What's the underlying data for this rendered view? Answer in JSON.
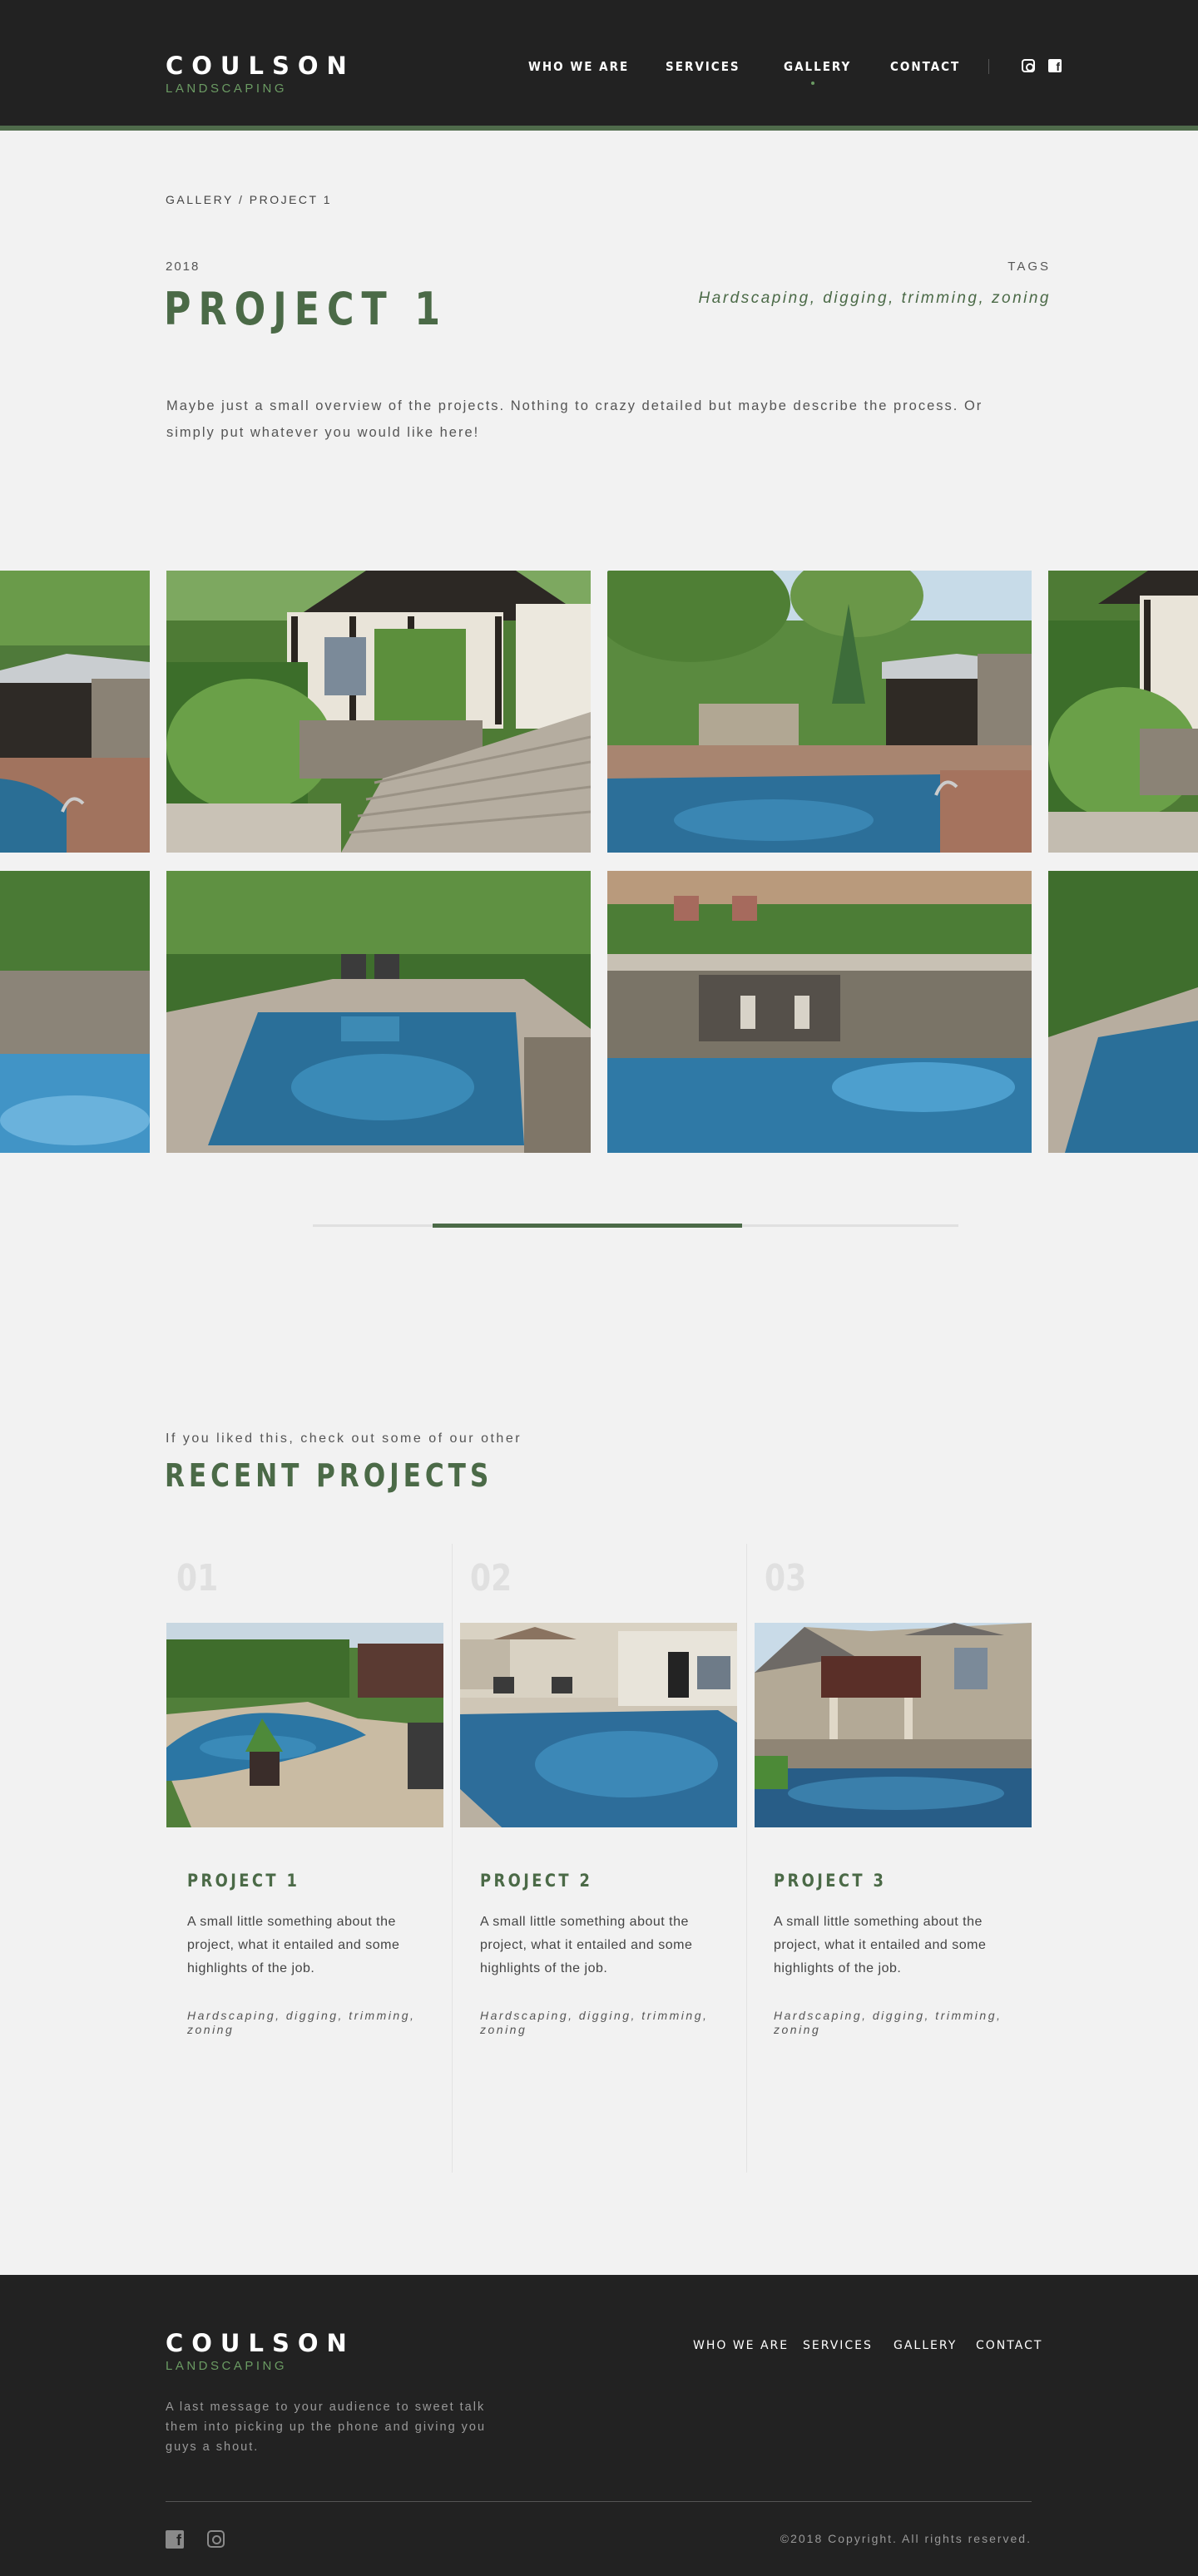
{
  "brand": {
    "name": "COULSON",
    "tagline": "LANDSCAPING"
  },
  "nav": {
    "items": [
      "WHO WE ARE",
      "SERVICES",
      "GALLERY",
      "CONTACT"
    ],
    "active": "GALLERY"
  },
  "social": {
    "icons": [
      "instagram-icon",
      "facebook-icon"
    ]
  },
  "breadcrumb": "GALLERY / PROJECT 1",
  "project": {
    "year": "2018",
    "title": "PROJECT 1",
    "tags_label": "TAGS",
    "tags": "Hardscaping, digging, trimming, zoning",
    "overview": "Maybe just a small overview of the projects. Nothing to crazy detailed but maybe describe the process. Or simply put whatever you would like here!"
  },
  "gallery": {
    "scroll_progress": 0.37
  },
  "recent": {
    "intro": "If you liked this, check out some of our other",
    "title": "RECENT PROJECTS",
    "cards": [
      {
        "num": "01",
        "title": "PROJECT 1",
        "text": "A small little something about the project, what it entailed and some highlights of the job.",
        "tags": "Hardscaping, digging, trimming, zoning"
      },
      {
        "num": "02",
        "title": "PROJECT 2",
        "text": "A small little something about the project, what it entailed and some highlights of the job.",
        "tags": "Hardscaping, digging, trimming, zoning"
      },
      {
        "num": "03",
        "title": "PROJECT 3",
        "text": "A small little something about the project, what it entailed and some highlights of the job.",
        "tags": "Hardscaping, digging, trimming, zoning"
      }
    ]
  },
  "footer": {
    "message": "A last message to your audience to sweet talk them into picking up the phone and giving you guys a shout.",
    "nav": [
      "WHO WE ARE",
      "SERVICES",
      "GALLERY",
      "CONTACT"
    ],
    "copyright": "©2018 Copyright. All rights reserved."
  },
  "colors": {
    "accent": "#4b6a47",
    "accent_light": "#6b9b63",
    "dark": "#222222",
    "background": "#f2f2f2"
  }
}
